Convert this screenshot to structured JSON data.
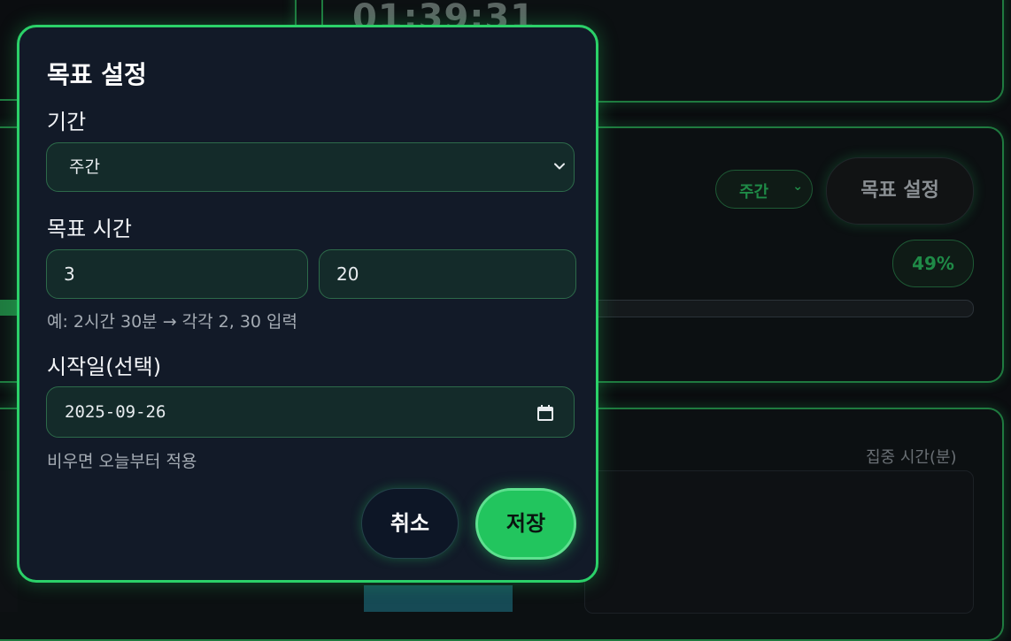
{
  "background": {
    "timer": "01:39:31",
    "period_select": "주간",
    "goal_button": "목표 설정",
    "progress_percent_label": "49%",
    "progress_fraction": 0.49,
    "chart_unit_label": "집중 시간(분)"
  },
  "modal": {
    "title": "목표 설정",
    "period": {
      "label": "기간",
      "value": "주간"
    },
    "goal_time": {
      "label": "목표 시간",
      "hours_value": "3",
      "minutes_value": "20",
      "hint": "예: 2시간 30분 → 각각 2, 30 입력"
    },
    "start_date": {
      "label": "시작일(선택)",
      "value": "2025-09-26",
      "hint": "비우면 오늘부터 적용"
    },
    "cancel_label": "취소",
    "save_label": "저장"
  },
  "colors": {
    "accent": "#22c55e",
    "modal_bg": "#121a28",
    "input_bg": "#142b2a"
  }
}
